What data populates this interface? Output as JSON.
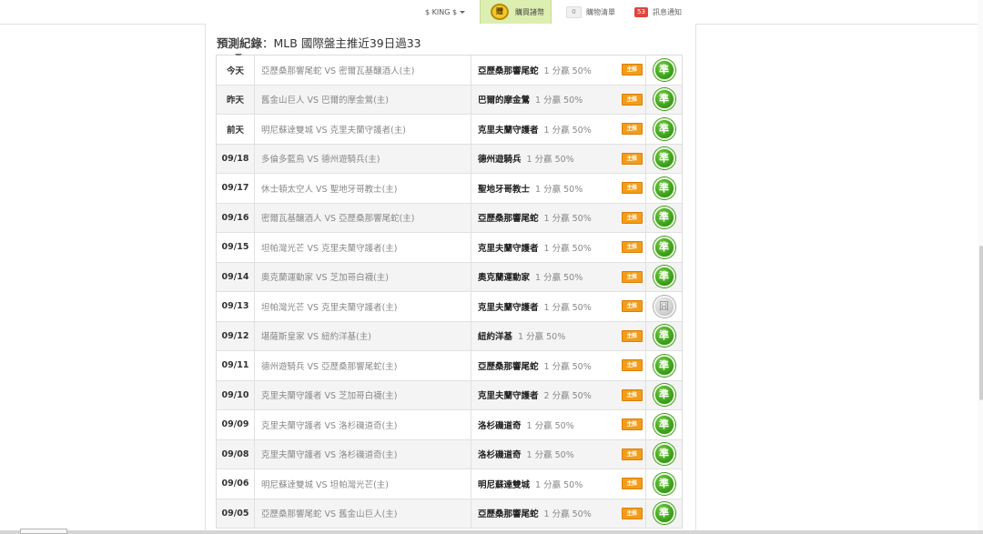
{
  "topbar": {
    "user": "$ KING $",
    "vip_medal": "贈",
    "vip_label": "購買諸幣",
    "cart_count": "0",
    "cart_label": "購物清單",
    "msg_count": "53",
    "msg_label": "訊息通知"
  },
  "page": {
    "title_bold": "預測紀錄",
    "title_rest": "：MLB 國際盤主推近39日過33"
  },
  "table": {
    "tag_label": "主推",
    "result_win": "準",
    "result_push": "囧",
    "rows": [
      {
        "date": "今天",
        "match": "亞歷桑那響尾蛇 VS 密爾瓦基釀酒人(主)",
        "pick": "亞歷桑那響尾蛇",
        "score": "1 分贏 50%",
        "result": "win"
      },
      {
        "date": "昨天",
        "match": "舊金山巨人 VS 巴爾的摩金鶯(主)",
        "pick": "巴爾的摩金鶯",
        "score": "1 分贏 50%",
        "result": "win"
      },
      {
        "date": "前天",
        "match": "明尼蘇達雙城 VS 克里夫蘭守護者(主)",
        "pick": "克里夫蘭守護者",
        "score": "1 分贏 50%",
        "result": "win"
      },
      {
        "date": "09/18",
        "match": "多倫多藍鳥 VS 德州遊騎兵(主)",
        "pick": "德州遊騎兵",
        "score": "1 分贏 50%",
        "result": "win"
      },
      {
        "date": "09/17",
        "match": "休士頓太空人 VS 聖地牙哥教士(主)",
        "pick": "聖地牙哥教士",
        "score": "1 分贏 50%",
        "result": "win"
      },
      {
        "date": "09/16",
        "match": "密爾瓦基釀酒人 VS 亞歷桑那響尾蛇(主)",
        "pick": "亞歷桑那響尾蛇",
        "score": "1 分贏 50%",
        "result": "win"
      },
      {
        "date": "09/15",
        "match": "坦帕灣光芒 VS 克里夫蘭守護者(主)",
        "pick": "克里夫蘭守護者",
        "score": "1 分贏 50%",
        "result": "win"
      },
      {
        "date": "09/14",
        "match": "奧克蘭運動家 VS 芝加哥白襪(主)",
        "pick": "奧克蘭運動家",
        "score": "1 分贏 50%",
        "result": "win"
      },
      {
        "date": "09/13",
        "match": "坦帕灣光芒 VS 克里夫蘭守護者(主)",
        "pick": "克里夫蘭守護者",
        "score": "1 分贏 50%",
        "result": "push"
      },
      {
        "date": "09/12",
        "match": "堪薩斯皇家 VS 紐約洋基(主)",
        "pick": "紐約洋基",
        "score": "1 分贏 50%",
        "result": "win"
      },
      {
        "date": "09/11",
        "match": "德州遊騎兵 VS 亞歷桑那響尾蛇(主)",
        "pick": "亞歷桑那響尾蛇",
        "score": "1 分贏 50%",
        "result": "win"
      },
      {
        "date": "09/10",
        "match": "克里夫蘭守護者 VS 芝加哥白襪(主)",
        "pick": "克里夫蘭守護者",
        "score": "2 分贏 50%",
        "result": "win"
      },
      {
        "date": "09/09",
        "match": "克里夫蘭守護者 VS 洛杉磯道奇(主)",
        "pick": "洛杉磯道奇",
        "score": "1 分贏 50%",
        "result": "win"
      },
      {
        "date": "09/08",
        "match": "克里夫蘭守護者 VS 洛杉磯道奇(主)",
        "pick": "洛杉磯道奇",
        "score": "1 分贏 50%",
        "result": "win"
      },
      {
        "date": "09/06",
        "match": "明尼蘇達雙城 VS 坦帕灣光芒(主)",
        "pick": "明尼蘇達雙城",
        "score": "1 分贏 50%",
        "result": "win"
      },
      {
        "date": "09/05",
        "match": "亞歷桑那響尾蛇 VS 舊金山巨人(主)",
        "pick": "亞歷桑那響尾蛇",
        "score": "1 分贏 50%",
        "result": "win"
      }
    ]
  }
}
